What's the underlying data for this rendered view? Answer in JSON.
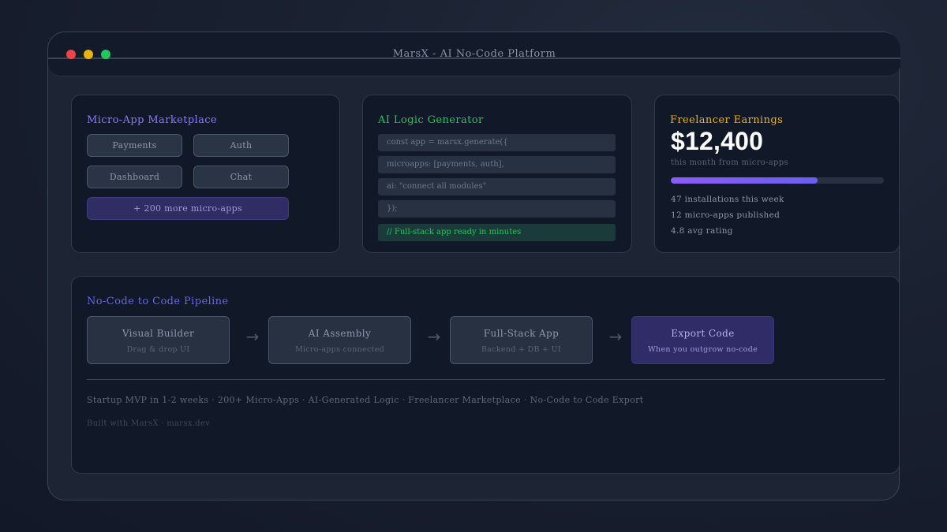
{
  "window": {
    "title": "MarsX - AI No-Code Platform"
  },
  "marketplace": {
    "title": "Micro-App Marketplace",
    "apps": [
      "Payments",
      "Auth",
      "Dashboard",
      "Chat"
    ],
    "more_label": "+ 200 more micro-apps"
  },
  "logic": {
    "title": "AI Logic Generator",
    "code_lines": [
      "const app = marsx.generate({",
      "microapps: [payments, auth],",
      "ai: \"connect all modules\"",
      "});"
    ],
    "result": "// Full-stack app ready in minutes"
  },
  "earnings": {
    "title": "Freelancer Earnings",
    "amount": "$12,400",
    "period": "this month from micro-apps",
    "progress_fraction": 0.69,
    "stats": [
      "47 installations this week",
      "12 micro-apps published",
      "4.8 avg rating"
    ]
  },
  "pipeline": {
    "title": "No-Code to Code Pipeline",
    "steps": [
      {
        "title": "Visual Builder",
        "subtitle": "Drag & drop UI"
      },
      {
        "title": "AI Assembly",
        "subtitle": "Micro-apps connected"
      },
      {
        "title": "Full-Stack App",
        "subtitle": "Backend + DB + UI"
      },
      {
        "title": "Export Code",
        "subtitle": "When you outgrow no-code"
      }
    ],
    "arrow_glyph": "→",
    "features": "Startup MVP in 1-2 weeks · 200+ Micro-Apps · AI-Generated Logic · Freelancer Marketplace · No-Code to Code Export",
    "footer": "Built with MarsX · marsx.dev"
  },
  "colors": {
    "marketplace_accent": "#8b7bf3",
    "logic_accent": "#22c55e",
    "earnings_accent": "#eab308",
    "pipeline_accent": "#6366f1",
    "progress": "#8b5cf6"
  }
}
